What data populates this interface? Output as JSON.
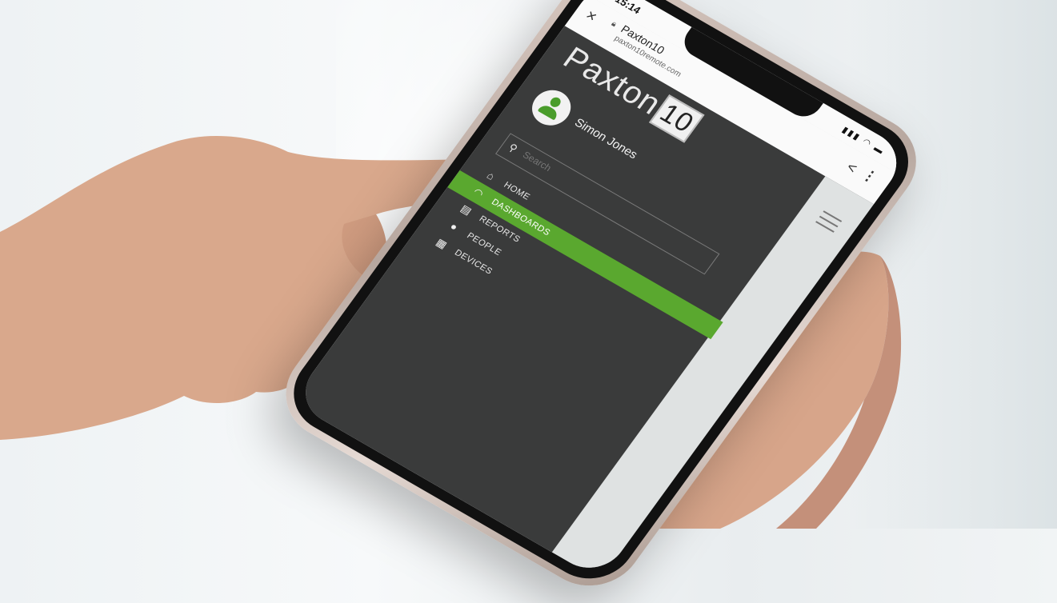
{
  "status_bar": {
    "time": "15:14"
  },
  "browser": {
    "title": "Paxton10",
    "url": "paxton10remote.com",
    "close_icon": "close-icon",
    "share_icon": "share-icon",
    "more_icon": "more-vertical-icon"
  },
  "app": {
    "logo_text": "Paxton",
    "logo_box": "10",
    "user_name": "Simon Jones",
    "search_placeholder": "Search",
    "nav": [
      {
        "label": "HOME",
        "icon": "home-icon",
        "active": false
      },
      {
        "label": "DASHBOARDS",
        "icon": "dashboard-icon",
        "active": true
      },
      {
        "label": "REPORTS",
        "icon": "reports-icon",
        "active": false
      },
      {
        "label": "PEOPLE",
        "icon": "person-icon",
        "active": false
      },
      {
        "label": "DEVICES",
        "icon": "devices-icon",
        "active": false
      }
    ]
  },
  "colors": {
    "accent_green": "#5aa82f",
    "app_background": "#3a3b3b"
  }
}
